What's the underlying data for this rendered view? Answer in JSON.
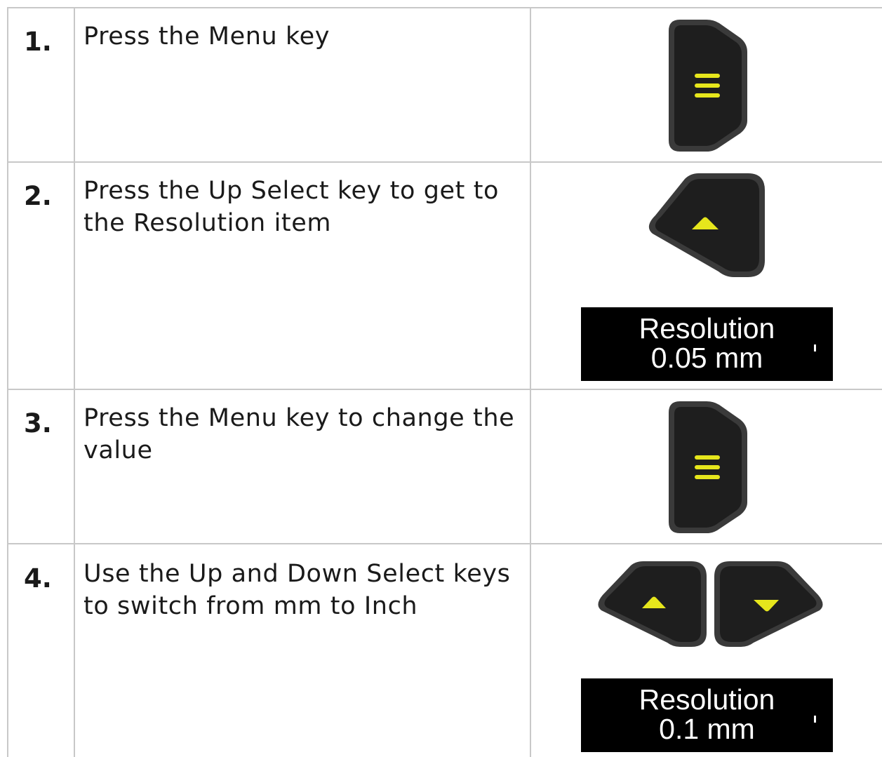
{
  "steps": [
    {
      "number": "1.",
      "text": "Press the Menu key"
    },
    {
      "number": "2.",
      "text": "Press the Up Select key to get to the Resolution item"
    },
    {
      "number": "3.",
      "text": "Press the Menu key to change the value"
    },
    {
      "number": "4.",
      "text": "Use the Up and Down Select keys to switch from mm to Inch"
    }
  ],
  "displays": [
    {
      "line1": "Resolution",
      "line2": "0.05 mm"
    },
    {
      "line1": "Resolution",
      "line2": "0.1 mm"
    }
  ],
  "colors": {
    "key_body": "#1e1e1e",
    "key_symbol": "#e6e61c",
    "border": "#c8c8c8"
  },
  "icons": [
    "menu-key-icon",
    "up-select-key-icon",
    "down-select-key-icon"
  ]
}
